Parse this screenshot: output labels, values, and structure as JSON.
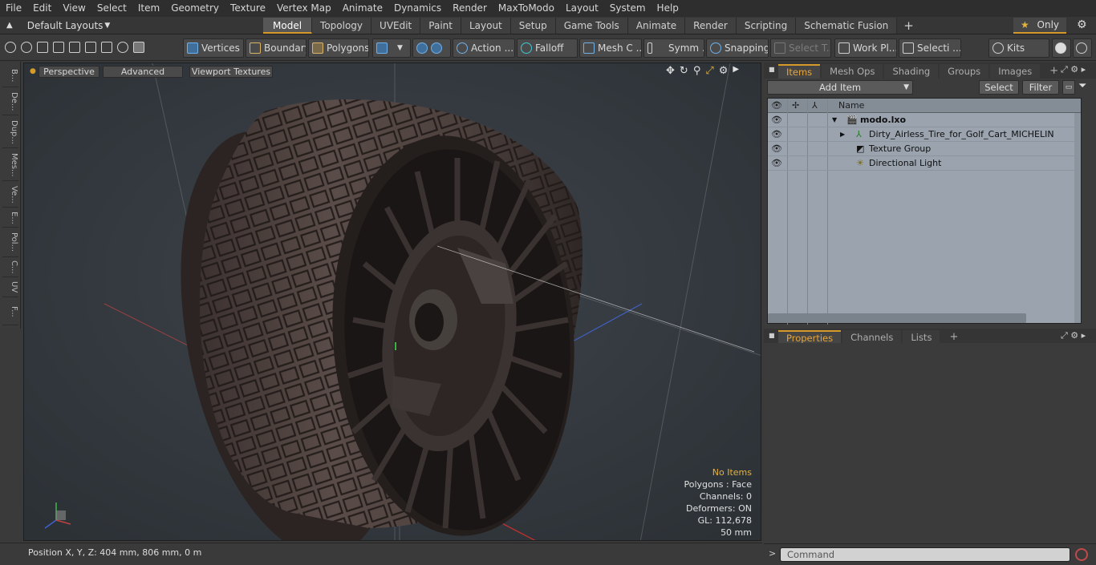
{
  "menu": [
    "File",
    "Edit",
    "View",
    "Select",
    "Item",
    "Geometry",
    "Texture",
    "Vertex Map",
    "Animate",
    "Dynamics",
    "Render",
    "MaxToModo",
    "Layout",
    "System",
    "Help"
  ],
  "layout_dropdown": "Default Layouts",
  "tabs": [
    "Model",
    "Topology",
    "UVEdit",
    "Paint",
    "Layout",
    "Setup",
    "Game Tools",
    "Animate",
    "Render",
    "Scripting",
    "Schematic Fusion"
  ],
  "active_tab": "Model",
  "only_label": "Only",
  "toolbar": {
    "vertices": "Vertices",
    "boundary": "Boundary",
    "polygons": "Polygons",
    "action": "Action",
    "falloff": "Falloff",
    "mesh": "Mesh C ...",
    "symm": "Symm ...",
    "snapping": "Snapping",
    "select_t": "Select T...",
    "work_pl": "Work Pl...",
    "selecti": "Selecti ...",
    "kits": "Kits"
  },
  "left_tabs": [
    "B...",
    "De...",
    "Dup...",
    "Mes...",
    "Ve...",
    "E...",
    "Pol...",
    "C...",
    "UV",
    "F..."
  ],
  "viewport": {
    "perspective": "Perspective",
    "advanced": "Advanced",
    "textures": "Viewport Textures",
    "info": {
      "items": "No Items",
      "polygons": "Polygons : Face",
      "channels": "Channels: 0",
      "deformers": "Deformers: ON",
      "gl": "GL: 112,678",
      "size": "50 mm"
    }
  },
  "status": "Position X, Y, Z:  404 mm, 806 mm, 0 m",
  "panel": {
    "tabs": [
      "Items",
      "Mesh Ops",
      "Shading",
      "Groups",
      "Images"
    ],
    "add_item": "Add Item",
    "select": "Select",
    "filter": "Filter",
    "name_header": "Name",
    "items": [
      {
        "label": "modo.lxo"
      },
      {
        "label": "Dirty_Airless_Tire_for_Golf_Cart_MICHELIN"
      },
      {
        "label": "Texture Group"
      },
      {
        "label": "Directional Light"
      }
    ],
    "prop_tabs": [
      "Properties",
      "Channels",
      "Lists"
    ],
    "command_placeholder": "Command"
  }
}
